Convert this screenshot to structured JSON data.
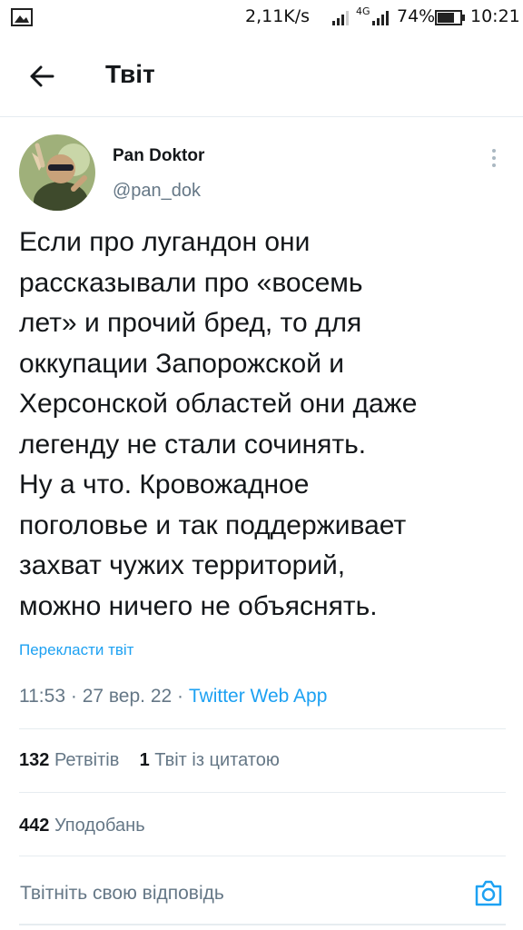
{
  "status_bar": {
    "speed": "2,11K/s",
    "network": "4G",
    "battery": "74%",
    "time": "10:21"
  },
  "header": {
    "title": "Твіт"
  },
  "tweet": {
    "author_name": "Pan Doktor",
    "author_handle": "@pan_dok",
    "text": "Если про лугандон они\nрассказывали про «восемь\nлет» и прочий бред, то для\nоккупации Запорожской и\nХерсонской областей они даже\nлегенду не стали сочинять.\nНу а что. Кровожадное\nпоголовье и так поддерживает\nзахват чужих территорий,\nможно ничего не объяснять.",
    "translate_label": "Перекласти твіт",
    "time": "11:53",
    "separator": "·",
    "date": "27 вер. 22",
    "source": "Twitter Web App"
  },
  "stats": {
    "retweets_count": "132",
    "retweets_label": "Ретвітів",
    "quotes_count": "1",
    "quotes_label": "Твіт із цитатою",
    "likes_count": "442",
    "likes_label": "Уподобань"
  },
  "reply": {
    "placeholder": "Твітніть свою відповідь"
  },
  "icons": {
    "back": "arrow-left-icon",
    "more": "more-vertical-icon",
    "camera": "camera-icon"
  },
  "colors": {
    "accent": "#1da1f2",
    "secondary_text": "#657786",
    "primary_text": "#14171a"
  }
}
